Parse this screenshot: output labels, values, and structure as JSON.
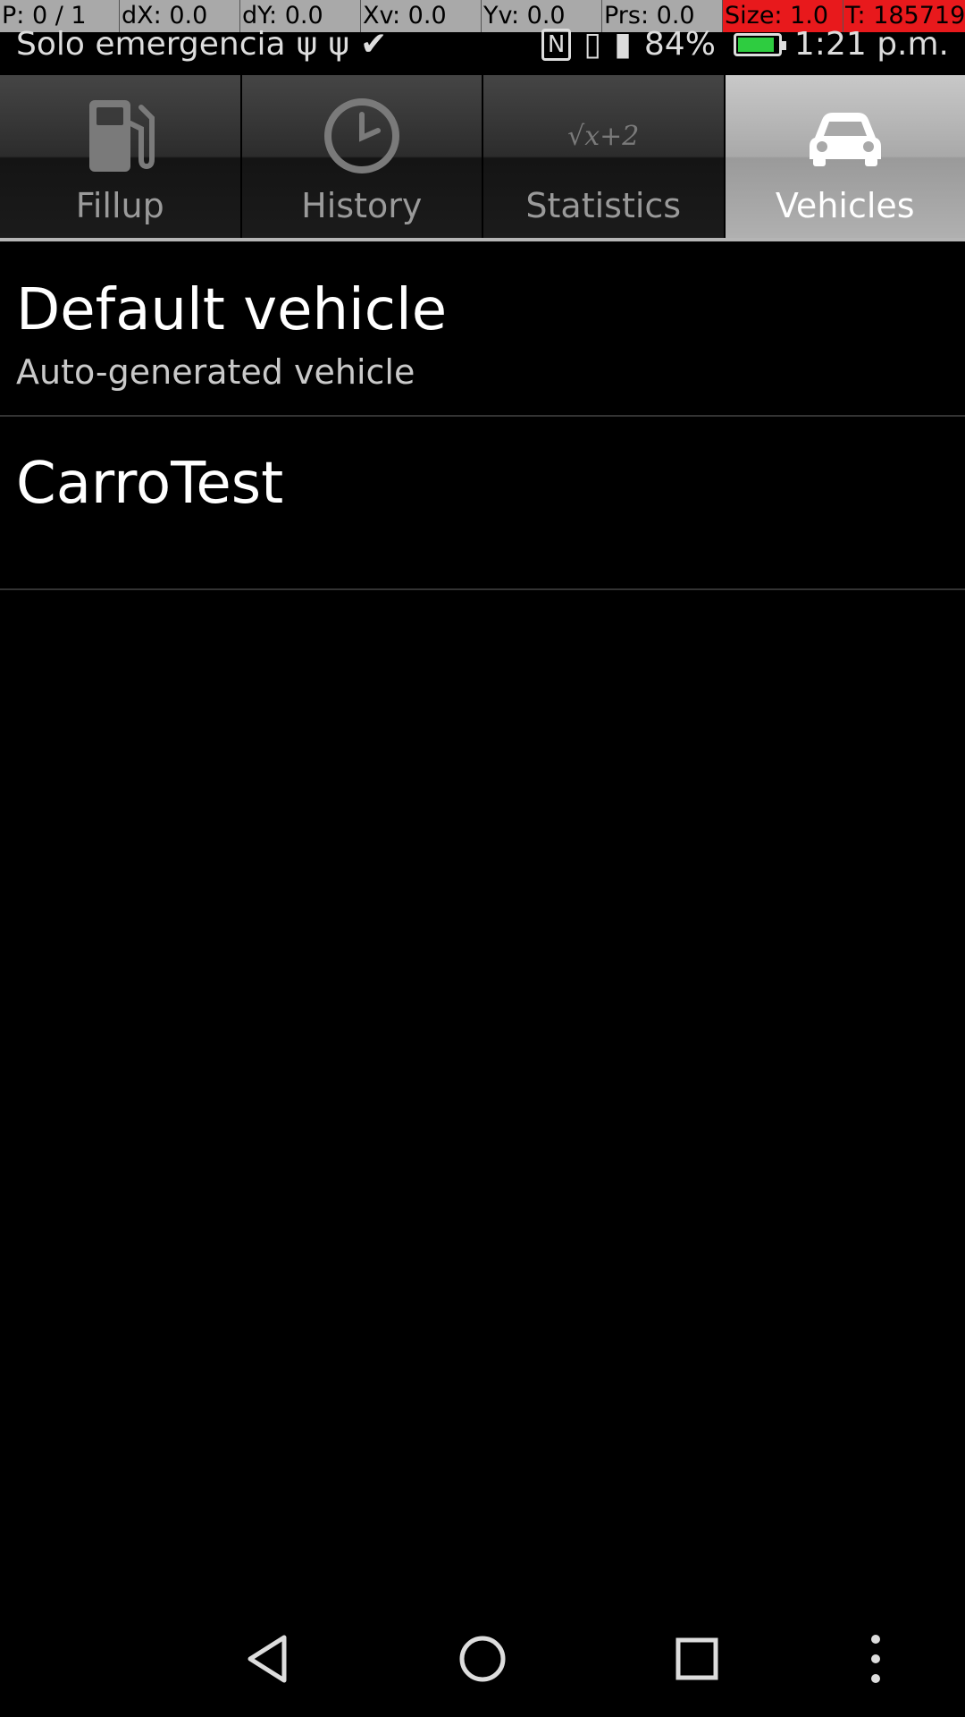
{
  "debug_overlay": {
    "cells": [
      "P: 0 / 1",
      "dX: 0.0",
      "dY: 0.0",
      "Xv: 0.0",
      "Yv: 0.0",
      "Prs: 0.0",
      "Size: 1.0",
      "T: 185719"
    ]
  },
  "status_bar": {
    "carrier": "Solo emergencia",
    "battery_percent": "84%",
    "time": "1:21 p.m.",
    "battery_color": "#2ecc40"
  },
  "tabs": [
    {
      "label": "Fillup",
      "icon": "fuel-pump-icon",
      "active": false
    },
    {
      "label": "History",
      "icon": "clock-icon",
      "active": false
    },
    {
      "label": "Statistics",
      "icon": "sqrt-formula-icon",
      "active": false
    },
    {
      "label": "Vehicles",
      "icon": "car-icon",
      "active": true
    }
  ],
  "statistics_icon_text": "√x+2",
  "vehicles": [
    {
      "name": "Default vehicle",
      "description": "Auto-generated vehicle"
    },
    {
      "name": "CarroTest",
      "description": ""
    }
  ],
  "nav_bar": {
    "buttons": [
      "back-icon",
      "home-icon",
      "recents-icon",
      "overflow-menu-icon"
    ]
  }
}
